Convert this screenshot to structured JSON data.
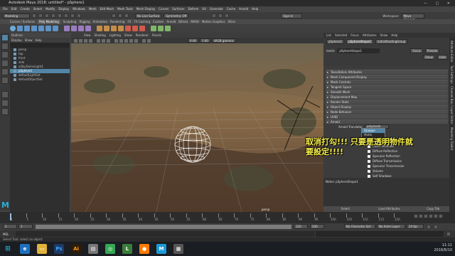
{
  "window": {
    "title": "Autodesk Maya 2018: untitled* - pSphere1"
  },
  "menubar": {
    "items": [
      "File",
      "Edit",
      "Create",
      "Select",
      "Modify",
      "Display",
      "Windows",
      "Mesh",
      "Edit Mesh",
      "Mesh Tools",
      "Mesh Display",
      "Curves",
      "Surfaces",
      "Deform",
      "UV",
      "Generate",
      "Cache",
      "Arnold",
      "Help"
    ]
  },
  "statusline": {
    "mode": "Modeling",
    "live": "No Live Surface",
    "symmetry": "Symmetry: Off",
    "signin": "Sign In",
    "workspace_label": "Workspace:",
    "workspace": "Maya Classic*"
  },
  "shelf": {
    "tabs": [
      "Curves / Surfaces",
      "Poly Modeling",
      "Sculpting",
      "Rigging",
      "Animation",
      "Rendering",
      "FX",
      "FX Caching",
      "Custom",
      "Arnold",
      "Bifrost",
      "MASH",
      "Motion Graphics",
      "XGen"
    ],
    "active": "Poly Modeling"
  },
  "outliner": {
    "title": "Outliner",
    "menu": [
      "Display",
      "Show",
      "Help"
    ],
    "items": [
      "persp",
      "top",
      "front",
      "side",
      "aiSkyDomeLight1",
      "pSphere1",
      "defaultLightSet",
      "defaultObjectSet"
    ],
    "selected": "pSphere1"
  },
  "viewport": {
    "menu": [
      "View",
      "Shading",
      "Lighting",
      "Show",
      "Renderer",
      "Panels"
    ],
    "camera": "persp",
    "gamma": "sRGB gamma",
    "exposure": "0.00",
    "gamma_val": "1.00"
  },
  "ae": {
    "tabs": [
      "List",
      "Selected",
      "Focus",
      "Attributes",
      "Show",
      "Help"
    ],
    "node_tabs": [
      "pSphere1",
      "pSphereShape1",
      "initialShadingGroup"
    ],
    "shape_label": "mesh:",
    "shape": "pSphereShape1",
    "focus": "Focus",
    "presets": "Presets",
    "show": "Show",
    "hide": "Hide",
    "sections": [
      "Tessellation Attributes",
      "Mesh Component Display",
      "Mesh Controls",
      "Tangent Space",
      "Smooth Mesh",
      "Displacement Map",
      "Render Stats",
      "Object Display",
      "Node Behavior",
      "UUID",
      "Arnold"
    ],
    "arnold_label": "Arnold Translator",
    "arnold_value": "polymesh",
    "dropdown": [
      "Opaque",
      "Matte"
    ],
    "checks": [
      "Casts Shadows",
      "Diffuse Reflection",
      "Specular Reflection",
      "Diffuse Transmission",
      "Specular Transmission",
      "Volume",
      "Self Shadows"
    ],
    "notes_label": "Notes: pSphereShape1",
    "buttons": [
      "Select",
      "Load Attributes",
      "Copy Tab"
    ],
    "side_tabs": [
      "Attribute Editor",
      "Tool Settings",
      "Channel Box / Layer Editor",
      "Modeling Toolkit"
    ]
  },
  "annotation": {
    "line1": "取消打勾!!! 只要是透明物件就",
    "line2": "要設定!!!!"
  },
  "timeline": {
    "ticks": [
      "1",
      "5",
      "10",
      "15",
      "20",
      "25",
      "30",
      "35",
      "40",
      "45",
      "50",
      "55",
      "60",
      "65",
      "70",
      "75",
      "80",
      "85",
      "90",
      "95",
      "100",
      "105",
      "110",
      "115",
      "120"
    ],
    "start": "1",
    "range_start": "1",
    "range_end": "120",
    "end": "200",
    "current": "1",
    "anim_layer": "No Anim Layer",
    "char_set": "No Character Set",
    "fps": "24 fps"
  },
  "cmd": {
    "lang": "MEL",
    "help": "Select Tool: select an object"
  },
  "taskbar": {
    "time": "11:11",
    "date": "2018/8/10"
  },
  "colors": {
    "selection": "#5285a6",
    "annotation": "#f7f04a",
    "maya_logo": "#27b0d6"
  }
}
